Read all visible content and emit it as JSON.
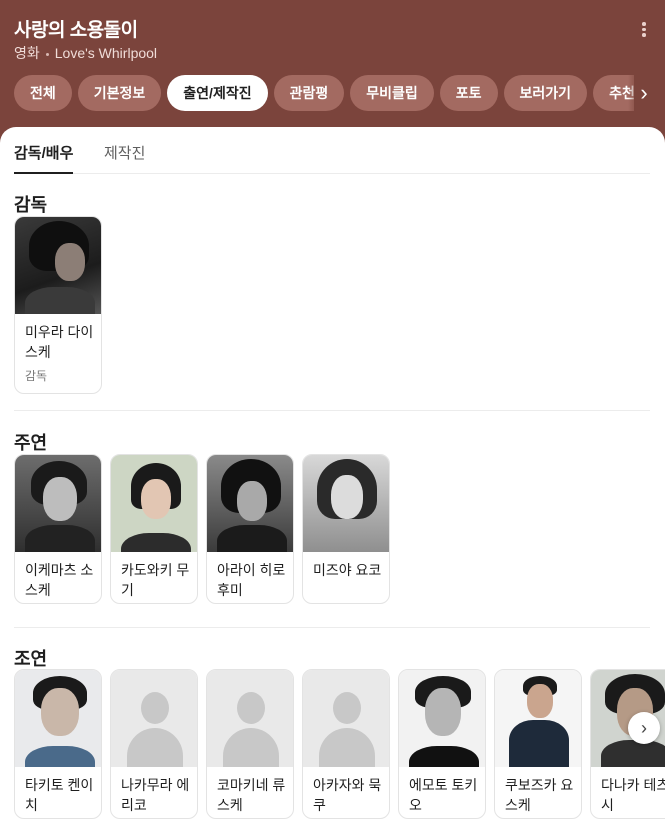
{
  "header": {
    "title": "사랑의 소용돌이",
    "category": "영화",
    "english_title": "Love's Whirlpool"
  },
  "chips": [
    {
      "label": "전체",
      "active": false
    },
    {
      "label": "기본정보",
      "active": false
    },
    {
      "label": "출연/제작진",
      "active": true
    },
    {
      "label": "관람평",
      "active": false
    },
    {
      "label": "무비클립",
      "active": false
    },
    {
      "label": "포토",
      "active": false
    },
    {
      "label": "보러가기",
      "active": false
    },
    {
      "label": "추천",
      "active": false
    }
  ],
  "tabs": {
    "cast": "감독/배우",
    "crew": "제작진"
  },
  "sections": {
    "director": {
      "title": "감독",
      "people": [
        {
          "name": "미우라 다이스케",
          "role": "감독"
        }
      ]
    },
    "lead": {
      "title": "주연",
      "people": [
        {
          "name": "이케마츠 소스케"
        },
        {
          "name": "카도와키 무기"
        },
        {
          "name": "아라이 히로후미"
        },
        {
          "name": "미즈야 요코"
        }
      ]
    },
    "supporting": {
      "title": "조연",
      "people": [
        {
          "name": "타키토 켄이치"
        },
        {
          "name": "나카무라 에리코"
        },
        {
          "name": "코마키네 류스케"
        },
        {
          "name": "아카자와 묵쿠"
        },
        {
          "name": "에모토 토키오"
        },
        {
          "name": "쿠보즈카 요스케"
        },
        {
          "name": "다나카 테츠시"
        }
      ]
    }
  },
  "icons": {
    "more": "more-vert-icon",
    "chip_next": "chevron-right-icon",
    "row_next": "chevron-right-icon"
  },
  "colors": {
    "header_bg": "#7b443c",
    "chip_bg": "#a36a61",
    "chip_active_bg": "#ffffff"
  }
}
